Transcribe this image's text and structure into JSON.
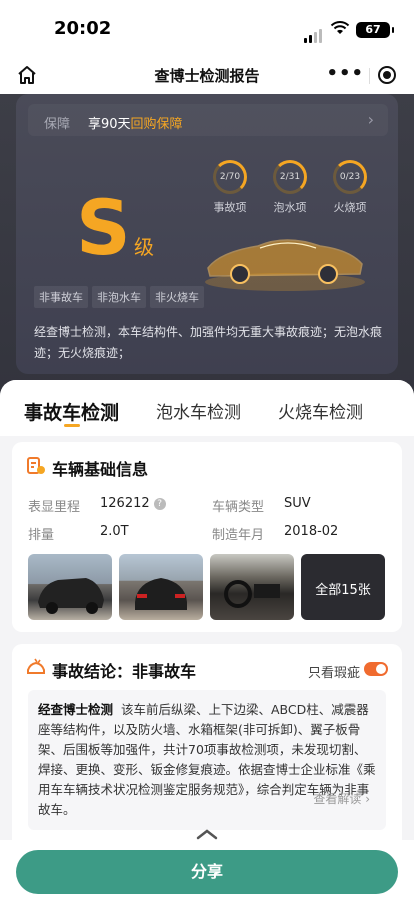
{
  "status_bar": {
    "time": "20:02",
    "battery": "67"
  },
  "nav": {
    "title": "查博士检测报告",
    "more": "•••"
  },
  "guarantee": {
    "label": "保障",
    "text_prefix": "享90天",
    "text_highlight": "回购保障",
    "arrow": "›"
  },
  "grade": {
    "letter": "S",
    "suffix": "级"
  },
  "stats": [
    {
      "value": "2/70",
      "label": "事故项"
    },
    {
      "value": "2/31",
      "label": "泡水项"
    },
    {
      "value": "0/23",
      "label": "火烧项"
    }
  ],
  "tags": [
    "非事故车",
    "非泡水车",
    "非火烧车"
  ],
  "summary": "经查博士检测，本车结构件、加强件均无重大事故痕迹；无泡水痕迹；无火烧痕迹；",
  "tabs": [
    "事故车检测",
    "泡水车检测",
    "火烧车检测"
  ],
  "basic_info": {
    "title": "车辆基础信息",
    "mileage_label": "表显里程",
    "mileage": "126212",
    "type_label": "车辆类型",
    "type": "SUV",
    "displacement_label": "排量",
    "displacement": "2.0T",
    "year_label": "制造年月",
    "year": "2018-02",
    "photos_more": "全部15张"
  },
  "conclusion": {
    "title": "事故结论：非事故车",
    "toggle_label": "只看瑕疵",
    "brand": "经查博士检测",
    "text": "该车前后纵梁、上下边梁、ABCD柱、减震器座等结构件，以及防火墙、水箱框架(非可拆卸)、翼子板骨架、后围板等加强件，共计70项事故检测项，未发现切割、焊接、更换、变形、钣金修复痕迹。依据查博士企业标准《乘用车车辆技术状况检测鉴定服务规范》，综合判定车辆为非事故车。",
    "read_more": "查看解读 ›"
  },
  "footer": {
    "share": "分享"
  },
  "colors": {
    "accent": "#f5a623",
    "share": "#3d9b86",
    "toggle": "#f06b2f"
  }
}
